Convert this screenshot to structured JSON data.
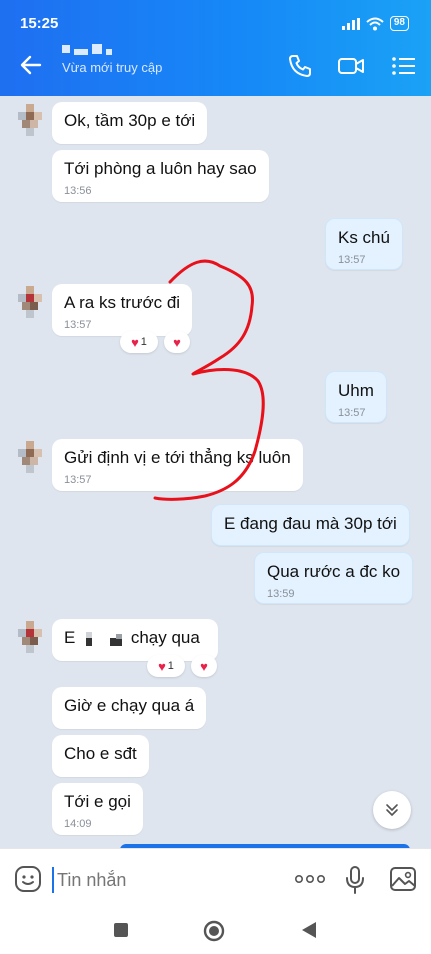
{
  "status": {
    "time": "15:25",
    "battery": "98"
  },
  "header": {
    "contact_name": "",
    "subtitle": "Vừa mới truy cập"
  },
  "messages": [
    {
      "text": "Ok, tầm 30p e tới",
      "time": ""
    },
    {
      "text": "Tới phòng a luôn hay sao",
      "time": "13:56"
    },
    {
      "text": "Ks chú",
      "time": "13:57"
    },
    {
      "text": "A ra ks trước đi",
      "time": "13:57"
    },
    {
      "text": "Uhm",
      "time": "13:57"
    },
    {
      "text": "Gửi định vị e tới thẳng ks luôn",
      "time": "13:57"
    },
    {
      "text": "E đang đau mà 30p tới",
      "time": ""
    },
    {
      "text": "Qua rước a đc ko",
      "time": "13:59"
    },
    {
      "text_prefix": "E",
      "text_suffix": "chạy qua",
      "time": ""
    },
    {
      "text": "Giờ e chạy qua á",
      "time": ""
    },
    {
      "text": "Cho e sđt",
      "time": ""
    },
    {
      "text": "Tới e gọi",
      "time": "14:09"
    }
  ],
  "reactions": [
    {
      "count": "1"
    },
    {
      "count": "1"
    }
  ],
  "input": {
    "placeholder": "Tin nhắn"
  },
  "colors": {
    "accent": "#1a73e8",
    "header": "#1688f7",
    "heart": "#e8224a",
    "annotation": "#e8101a"
  },
  "icons": [
    "back-arrow-icon",
    "phone-icon",
    "video-call-icon",
    "menu-list-icon",
    "emoji-icon",
    "more-dots-icon",
    "microphone-icon",
    "image-icon",
    "chevron-double-down-icon",
    "nav-square-icon",
    "nav-circle-icon",
    "nav-triangle-icon"
  ]
}
